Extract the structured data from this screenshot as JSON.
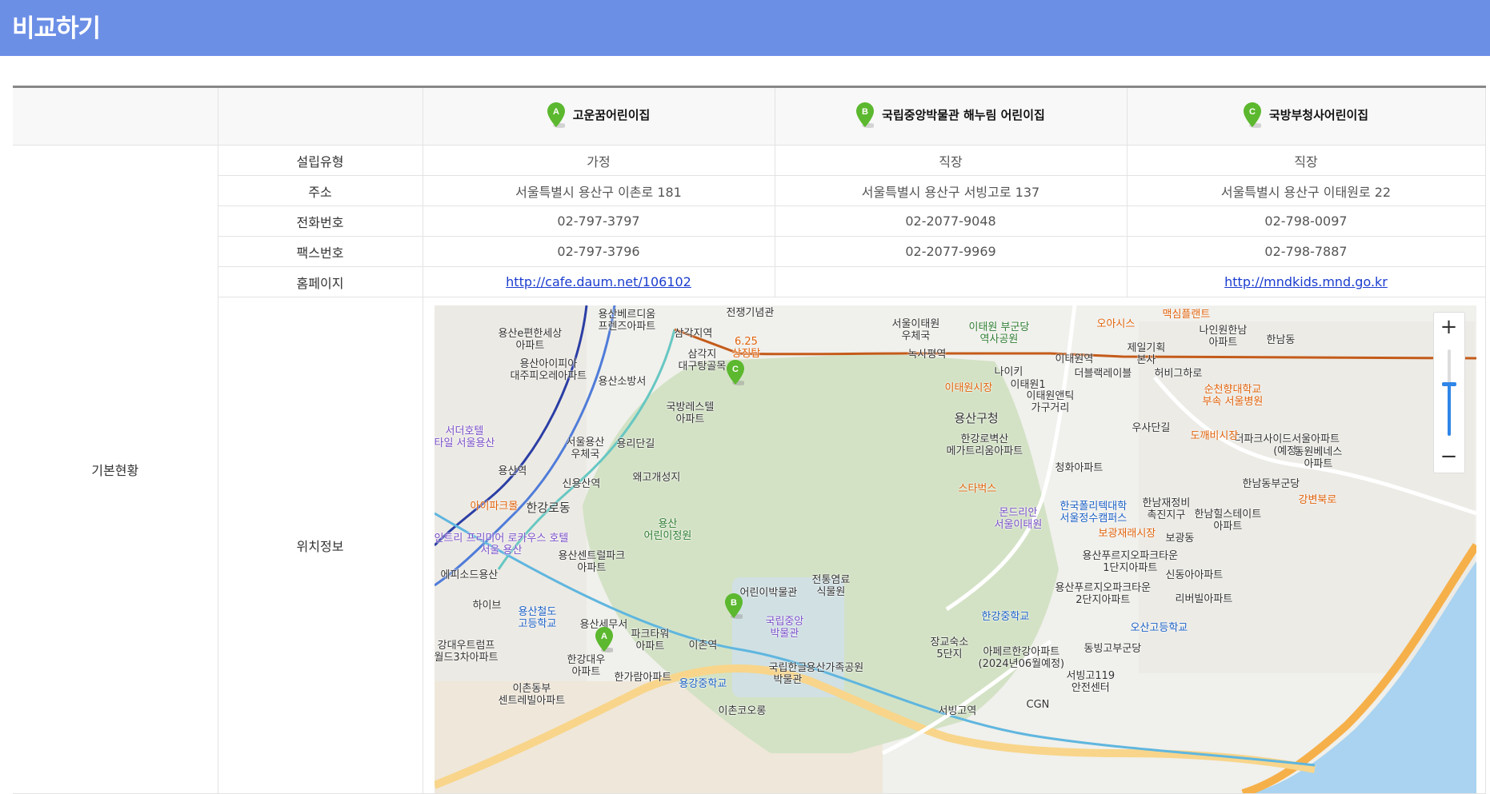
{
  "page": {
    "title": "비교하기"
  },
  "colors": {
    "header_bg": "#6c8fe6",
    "link": "#1a3ccf",
    "pin_green": "#5cb82e"
  },
  "facilities": [
    {
      "marker": "A",
      "name": "고운꿈어린이집"
    },
    {
      "marker": "B",
      "name": "국립중앙박물관 해누림 어린이집"
    },
    {
      "marker": "C",
      "name": "국방부청사어린이집"
    }
  ],
  "section": {
    "basic": "기본현황"
  },
  "rows": {
    "type": {
      "label": "설립유형",
      "values": [
        "가정",
        "직장",
        "직장"
      ]
    },
    "address": {
      "label": "주소",
      "values": [
        "서울특별시 용산구 이촌로 181",
        "서울특별시 용산구 서빙고로 137",
        "서울특별시 용산구 이태원로 22"
      ]
    },
    "phone": {
      "label": "전화번호",
      "values": [
        "02-797-3797",
        "02-2077-9048",
        "02-798-0097"
      ]
    },
    "fax": {
      "label": "팩스번호",
      "values": [
        "02-797-3796",
        "02-2077-9969",
        "02-798-7887"
      ]
    },
    "homepage": {
      "label": "홈페이지",
      "values": [
        "http://cafe.daum.net/106102",
        "",
        "http://mndkids.mnd.go.kr"
      ]
    },
    "location": {
      "label": "위치정보"
    }
  },
  "map": {
    "zoom_in": "+",
    "zoom_out": "−",
    "zoom_level": 0.6,
    "labels": [
      "용산베르디움\n프렌즈아파트",
      "삼각지역",
      "전쟁기념관",
      "6.25\n상징탑",
      "서울이태원\n우체국",
      "이태원 부군당\n역사공원",
      "오아시스",
      "맥심플랜트",
      "나인원한남\n아파트",
      "한남동",
      "용산e편한세상\n아파트",
      "용산아이피아\n대주피오레아파트",
      "삼각지\n대구탕골목",
      "녹사평역",
      "이태원역",
      "제일기획\n본사",
      "나이키",
      "더블랙레이블",
      "허비그하로",
      "순천향대학교\n부속 서울병원",
      "용산소방서",
      "이태원1",
      "이태원앤틱\n가구거리",
      "이태원시장",
      "용산구청",
      "우사단길",
      "한강로벽산\n메가트리움아파트",
      "국방레스텔\n아파트",
      "서울용산\n우체국",
      "용리단길",
      "더파크사이드서울아파트\n(예정)",
      "도깨비시장",
      "동원베네스\n아파트",
      "서더호텔\n타일 서울용산",
      "청화아파트",
      "용산역",
      "신용산역",
      "왜고개성지",
      "스타벅스",
      "한남동부군당",
      "아이파크몰",
      "한강로동",
      "몬드리안\n서울이태원",
      "한국폴리텍대학\n서울정수캠퍼스",
      "한남재정비\n촉진지구",
      "한남힐스테이트\n아파트",
      "용산\n어린이정원",
      "보광재래시장",
      "보광동",
      "인트리 프리미어 로카우스 호텔\n서울 용산",
      "용산센트럴파크\n아파트",
      "용산푸르지오파크타운\n1단지아파트",
      "에피소드용산",
      "전통염료\n식물원",
      "신동아아파트",
      "어린이박물관",
      "하이브",
      "용산푸르지오파크타운\n2단지아파트",
      "리버빌아파트",
      "용산철도\n고등학교",
      "용산세무서",
      "국립중앙\n박물관",
      "한강중학교",
      "오산고등학교",
      "강대우트럼프\n월드3차아파트",
      "파크타워\n아파트",
      "이촌역",
      "장교숙소\n5단지",
      "아페르한강아파트\n(2024년06월예정)",
      "동빙고부군당",
      "한강대우\n아파트",
      "한가람아파트",
      "국립한글\n박물관",
      "용산가족공원",
      "서빙고119\n안전센터",
      "용강중학교",
      "이촌동부\n센트레빌아파트",
      "서빙고역",
      "CGN",
      "이촌코오롱",
      "강변북로"
    ]
  }
}
